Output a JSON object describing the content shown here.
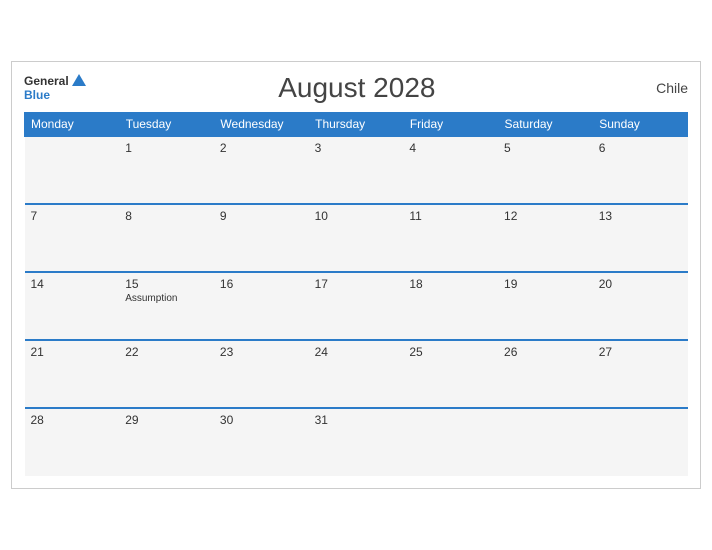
{
  "header": {
    "title": "August 2028",
    "country": "Chile",
    "logo_general": "General",
    "logo_blue": "Blue"
  },
  "weekdays": [
    "Monday",
    "Tuesday",
    "Wednesday",
    "Thursday",
    "Friday",
    "Saturday",
    "Sunday"
  ],
  "weeks": [
    [
      {
        "day": "",
        "empty": true
      },
      {
        "day": "1"
      },
      {
        "day": "2"
      },
      {
        "day": "3"
      },
      {
        "day": "4"
      },
      {
        "day": "5"
      },
      {
        "day": "6"
      }
    ],
    [
      {
        "day": "7"
      },
      {
        "day": "8"
      },
      {
        "day": "9"
      },
      {
        "day": "10"
      },
      {
        "day": "11"
      },
      {
        "day": "12"
      },
      {
        "day": "13"
      }
    ],
    [
      {
        "day": "14"
      },
      {
        "day": "15",
        "holiday": "Assumption"
      },
      {
        "day": "16"
      },
      {
        "day": "17"
      },
      {
        "day": "18"
      },
      {
        "day": "19"
      },
      {
        "day": "20"
      }
    ],
    [
      {
        "day": "21"
      },
      {
        "day": "22"
      },
      {
        "day": "23"
      },
      {
        "day": "24"
      },
      {
        "day": "25"
      },
      {
        "day": "26"
      },
      {
        "day": "27"
      }
    ],
    [
      {
        "day": "28"
      },
      {
        "day": "29"
      },
      {
        "day": "30"
      },
      {
        "day": "31"
      },
      {
        "day": "",
        "empty": true
      },
      {
        "day": "",
        "empty": true
      },
      {
        "day": "",
        "empty": true
      }
    ]
  ]
}
